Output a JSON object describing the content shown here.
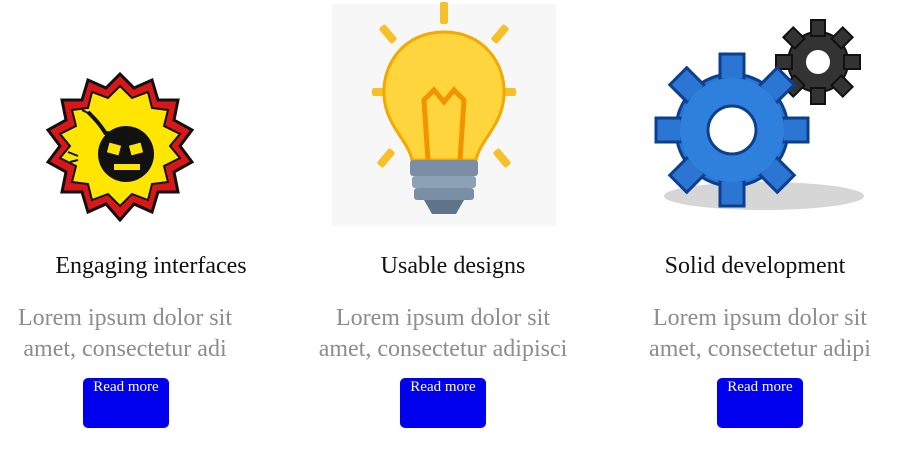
{
  "cards": [
    {
      "icon": "bomb-badge-icon",
      "title": "Engaging interfaces",
      "desc_line1": "Lorem ipsum dolor sit",
      "desc_line2": "amet, consectetur adi",
      "button": "Read more"
    },
    {
      "icon": "lightbulb-icon",
      "title": "Usable designs",
      "desc_line1": "Lorem ipsum dolor sit",
      "desc_line2": "amet, consectetur adipisci",
      "button": "Read more"
    },
    {
      "icon": "gears-icon",
      "title": "Solid development",
      "desc_line1": "Lorem ipsum dolor sit",
      "desc_line2": "amet, consectetur adipi",
      "button": "Read more"
    }
  ],
  "colors": {
    "button": "#0000ee",
    "desc_text": "#8d8d8d",
    "title_text": "#111111"
  }
}
